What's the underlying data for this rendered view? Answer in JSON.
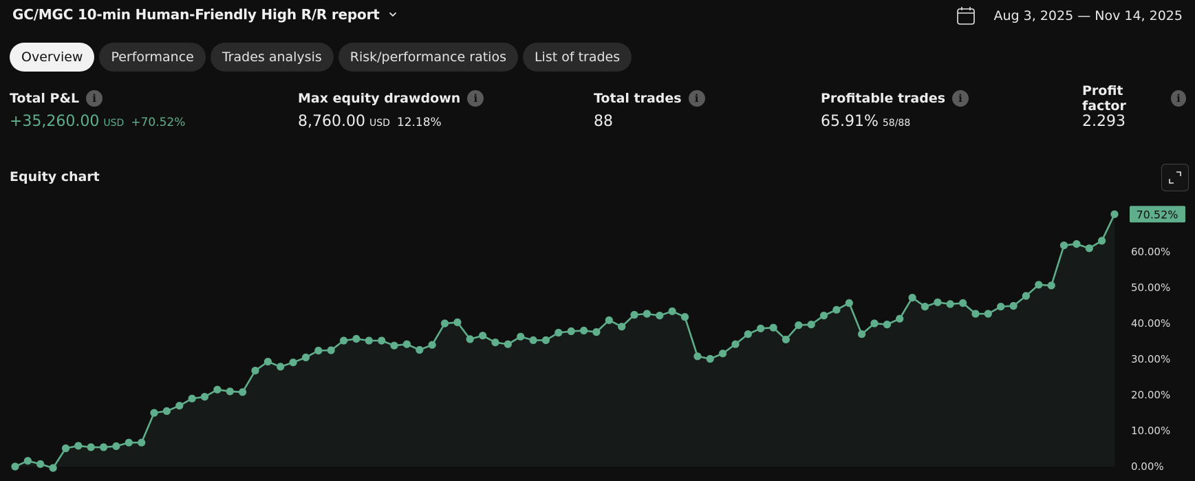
{
  "header": {
    "title": "GC/MGC 10-min Human-Friendly High R/R report",
    "date_range": "Aug 3, 2025 — Nov 14, 2025"
  },
  "tabs": [
    {
      "label": "Overview",
      "active": true
    },
    {
      "label": "Performance",
      "active": false
    },
    {
      "label": "Trades analysis",
      "active": false
    },
    {
      "label": "Risk/performance ratios",
      "active": false
    },
    {
      "label": "List of trades",
      "active": false
    }
  ],
  "metrics": {
    "total_pnl": {
      "label": "Total P&L",
      "value": "+35,260.00",
      "unit": "USD",
      "percent": "+70.52%"
    },
    "max_drawdown": {
      "label": "Max equity drawdown",
      "value": "8,760.00",
      "unit": "USD",
      "percent": "12.18%"
    },
    "total_trades": {
      "label": "Total trades",
      "value": "88"
    },
    "profitable_trades": {
      "label": "Profitable trades",
      "value": "65.91%",
      "sub": "58/88"
    },
    "profit_factor": {
      "label": "Profit factor",
      "value": "2.293"
    }
  },
  "colors": {
    "accent": "#5fae8c",
    "background": "#0f0f0f",
    "tab_bg": "#2a2a2a",
    "tab_active_bg": "#f2f2f2"
  },
  "icons": [
    "chevron-down-icon",
    "calendar-icon",
    "info-icon",
    "expand-icon"
  ],
  "chart_data": {
    "type": "line",
    "title": "Equity chart",
    "last_value_label": "70.52%",
    "y_ticks": [
      "0.00%",
      "10.00%",
      "20.00%",
      "30.00%",
      "40.00%",
      "50.00%",
      "60.00%"
    ],
    "ylim": [
      0,
      72
    ],
    "grid": false,
    "series": [
      {
        "values": [
          0.0,
          1.6,
          0.7,
          -0.4,
          5.1,
          5.8,
          5.4,
          5.4,
          5.7,
          6.7,
          6.7,
          15.0,
          15.5,
          17.0,
          19.0,
          19.5,
          21.5,
          21.0,
          20.8,
          26.8,
          29.3,
          27.9,
          29.1,
          30.5,
          32.4,
          32.5,
          35.2,
          35.7,
          35.2,
          35.2,
          33.8,
          34.2,
          32.6,
          34.0,
          40.0,
          40.3,
          35.6,
          36.6,
          34.7,
          34.2,
          36.3,
          35.3,
          35.3,
          37.4,
          37.8,
          38.0,
          37.6,
          40.9,
          39.1,
          42.4,
          42.7,
          42.2,
          43.4,
          41.8,
          30.8,
          30.1,
          31.6,
          34.2,
          37.0,
          38.6,
          38.8,
          35.5,
          39.5,
          39.7,
          42.2,
          43.8,
          45.7,
          37.0,
          40.0,
          39.7,
          41.3,
          47.2,
          44.7,
          45.9,
          45.4,
          45.7,
          42.7,
          42.7,
          44.7,
          44.9,
          47.7,
          50.8,
          50.6,
          61.8,
          62.2,
          61.0,
          63.1,
          70.52
        ]
      }
    ]
  }
}
